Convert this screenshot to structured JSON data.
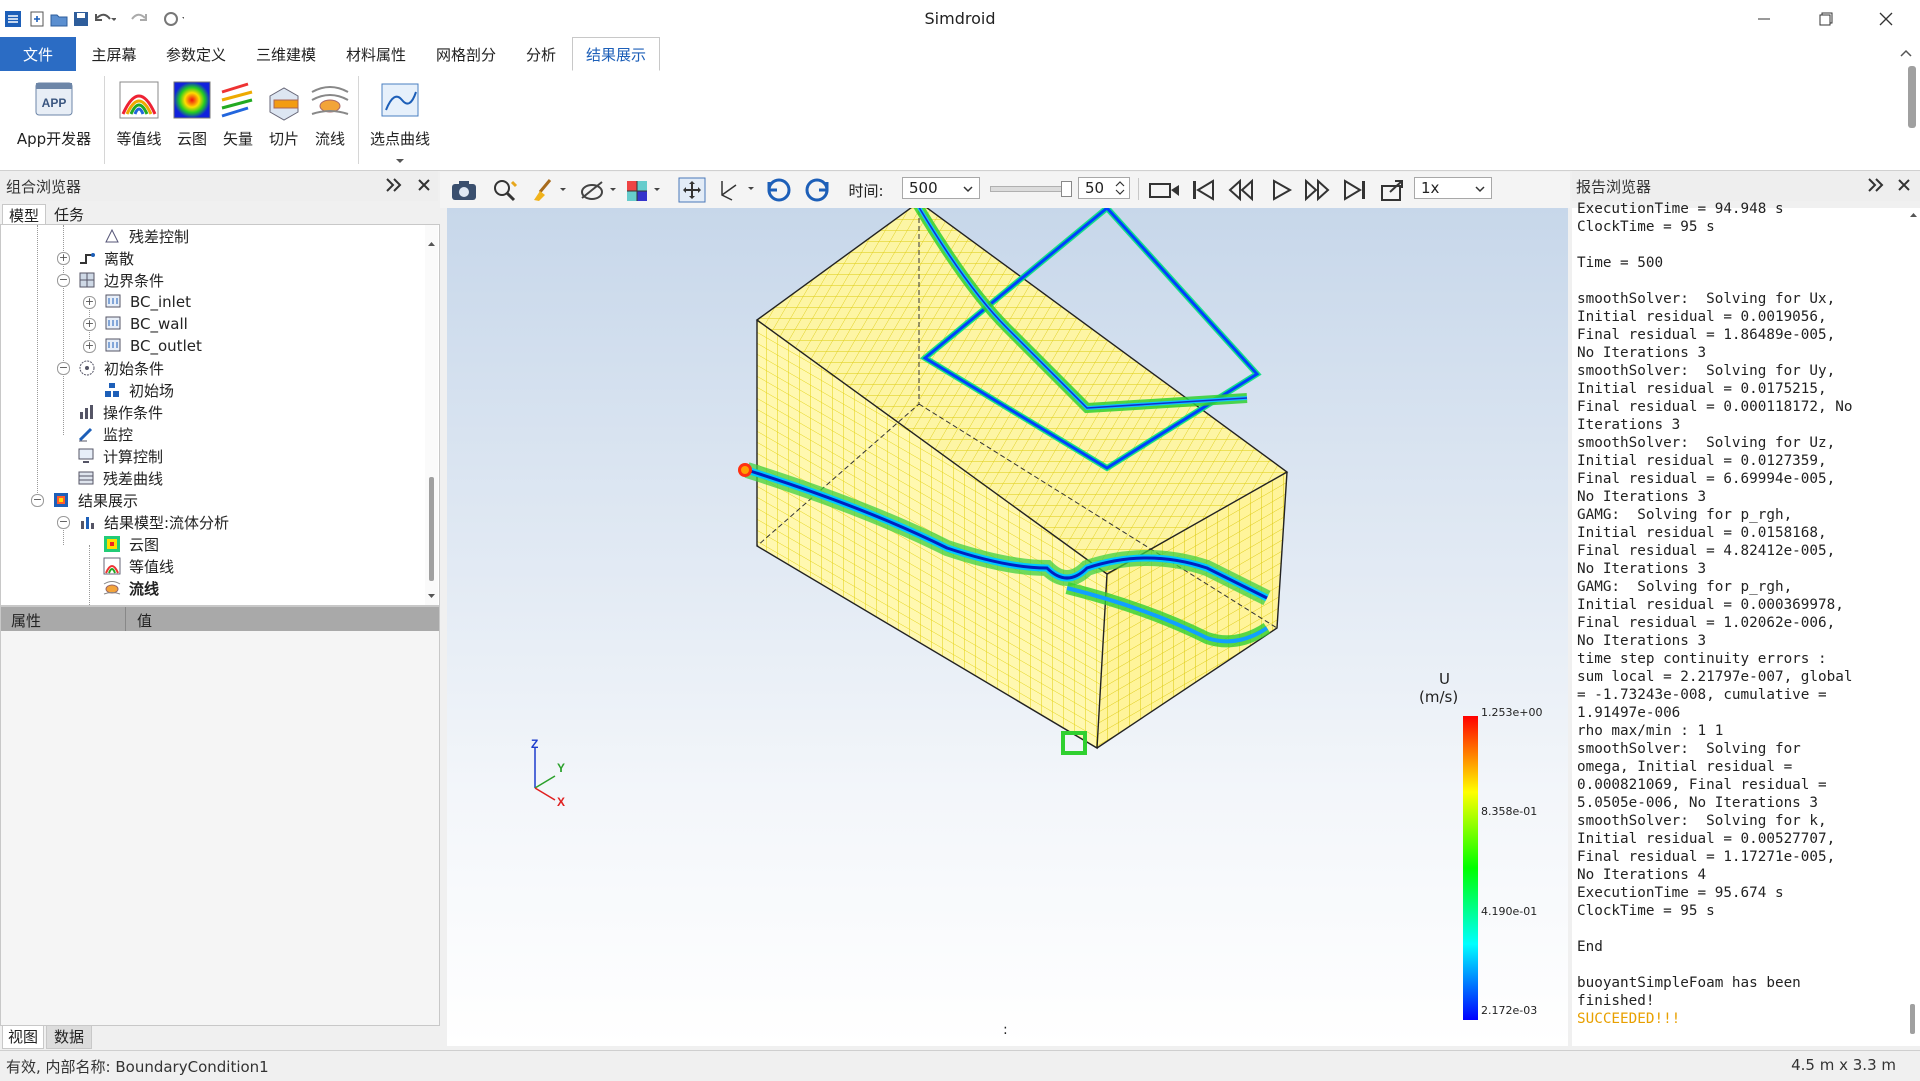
{
  "window": {
    "title": "Simdroid"
  },
  "menu_tabs": [
    "文件",
    "主屏幕",
    "参数定义",
    "三维建模",
    "材料属性",
    "网格剖分",
    "分析",
    "结果展示"
  ],
  "active_tab": "结果展示",
  "ribbon": {
    "app_dev": "App开发器",
    "app_icon_text": "APP",
    "contour": "等值线",
    "cloud": "云图",
    "vector": "矢量",
    "slice": "切片",
    "streamline": "流线",
    "point_curve": "选点曲线"
  },
  "combo_browser": {
    "title": "组合浏览器",
    "tabs": [
      "模型",
      "任务"
    ],
    "tree": [
      {
        "label": "残差控制",
        "icon": "residual-control-icon"
      },
      {
        "label": "离散",
        "icon": "discrete-icon"
      },
      {
        "label": "边界条件",
        "icon": "boundary-icon"
      },
      {
        "label": "BC_inlet",
        "icon": "bc-icon"
      },
      {
        "label": "BC_wall",
        "icon": "bc-icon"
      },
      {
        "label": "BC_outlet",
        "icon": "bc-icon"
      },
      {
        "label": "初始条件",
        "icon": "initial-condition-icon"
      },
      {
        "label": "初始场",
        "icon": "initial-field-icon"
      },
      {
        "label": "操作条件",
        "icon": "operating-condition-icon"
      },
      {
        "label": "监控",
        "icon": "monitor-icon"
      },
      {
        "label": "计算控制",
        "icon": "compute-control-icon"
      },
      {
        "label": "残差曲线",
        "icon": "residual-curve-icon"
      },
      {
        "label": "结果展示",
        "icon": "results-icon"
      },
      {
        "label": "结果模型:流体分析",
        "icon": "result-model-icon"
      },
      {
        "label": "云图",
        "icon": "cloud-map-icon"
      },
      {
        "label": "等值线",
        "icon": "contour-icon"
      },
      {
        "label": "流线",
        "icon": "streamline-icon"
      }
    ]
  },
  "properties": {
    "col_property": "属性",
    "col_value": "值"
  },
  "bottom_tabs": [
    "视图",
    "数据"
  ],
  "view_toolbar": {
    "time_label": "时间:",
    "time_value": "500",
    "step_value": "50",
    "speed_value": "1x"
  },
  "legend": {
    "title": "U",
    "unit": "(m/s)",
    "max": "1.253e+00",
    "v2": "8.358e-01",
    "v3": "4.190e-01",
    "min": "2.172e-03",
    "colors": [
      "#ff0000",
      "#ffff00",
      "#00ff00",
      "#00ffff",
      "#0000ff"
    ]
  },
  "axes_triad": {
    "x": "X",
    "y": "Y",
    "z": "Z"
  },
  "report_browser": {
    "title": "报告浏览器",
    "log": "ExecutionTime = 94.948 s\nClockTime = 95 s\n\nTime = 500\n\nsmoothSolver:  Solving for Ux,\nInitial residual = 0.0019056,\nFinal residual = 1.86489e-005,\nNo Iterations 3\nsmoothSolver:  Solving for Uy,\nInitial residual = 0.0175215,\nFinal residual = 0.000118172, No\nIterations 3\nsmoothSolver:  Solving for Uz,\nInitial residual = 0.0127359,\nFinal residual = 6.69994e-005,\nNo Iterations 3\nGAMG:  Solving for p_rgh,\nInitial residual = 0.0158168,\nFinal residual = 4.82412e-005,\nNo Iterations 3\nGAMG:  Solving for p_rgh,\nInitial residual = 0.000369978,\nFinal residual = 1.02062e-006,\nNo Iterations 3\ntime step continuity errors :\nsum local = 2.21797e-007, global\n= -1.73243e-008, cumulative =\n1.91497e-006\nrho max/min : 1 1\nsmoothSolver:  Solving for\nomega, Initial residual =\n0.000821069, Final residual =\n5.0505e-006, No Iterations 3\nsmoothSolver:  Solving for k,\nInitial residual = 0.00527707,\nFinal residual = 1.17271e-005,\nNo Iterations 4\nExecutionTime = 95.674 s\nClockTime = 95 s\n\nEnd\n\nbuoyantSimpleFoam has been\nfinished!",
    "success": "SUCCEEDED!!!"
  },
  "status": {
    "left": "有效, 内部名称: BoundaryCondition1",
    "right": "4.5 m x 3.3 m",
    "center_mark": ":"
  }
}
